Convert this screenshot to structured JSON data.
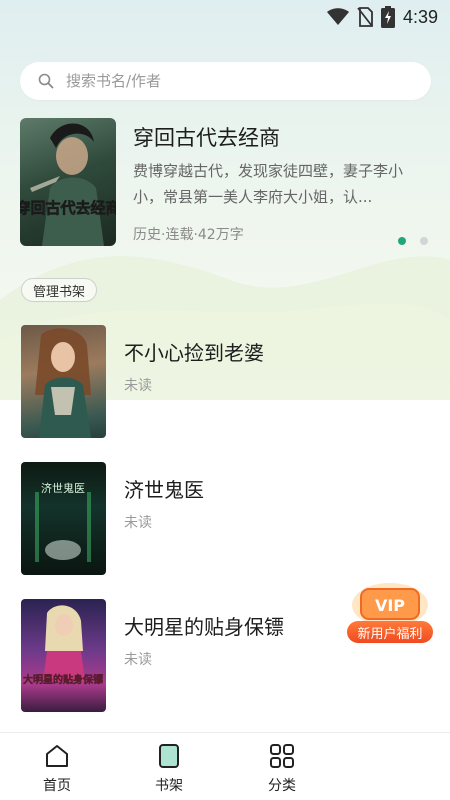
{
  "status_bar": {
    "time": "4:39",
    "icons": [
      "wifi-icon",
      "no-sim-icon",
      "battery-charging-icon"
    ]
  },
  "search": {
    "placeholder": "搜索书名/作者",
    "icon": "search-icon"
  },
  "featured": {
    "title": "穿回古代去经商",
    "description": "费博穿越古代，发现家徒四壁，妻子李小小，常县第一美人李府大小姐，认...",
    "meta": "历史·连载·42万字",
    "cover_text": "穿回古代去经商",
    "carousel": {
      "count": 2,
      "active_index": 0
    }
  },
  "shelf": {
    "manage_label": "管理书架",
    "books": [
      {
        "title": "不小心捡到老婆",
        "status": "未读"
      },
      {
        "title": "济世鬼医",
        "status": "未读",
        "cover_text": "济世鬼医"
      },
      {
        "title": "大明星的贴身保镖",
        "status": "未读",
        "cover_text": "大明星的贴身保镖"
      }
    ]
  },
  "promo": {
    "vip_text": "VIP",
    "label": "新用户福利"
  },
  "bottom_nav": {
    "items": [
      {
        "label": "首页",
        "icon": "home-icon"
      },
      {
        "label": "书架",
        "icon": "bookshelf-icon",
        "active": true
      },
      {
        "label": "分类",
        "icon": "category-grid-icon"
      }
    ]
  },
  "colors": {
    "accent": "#20a67e",
    "promo": "#f04a20"
  }
}
